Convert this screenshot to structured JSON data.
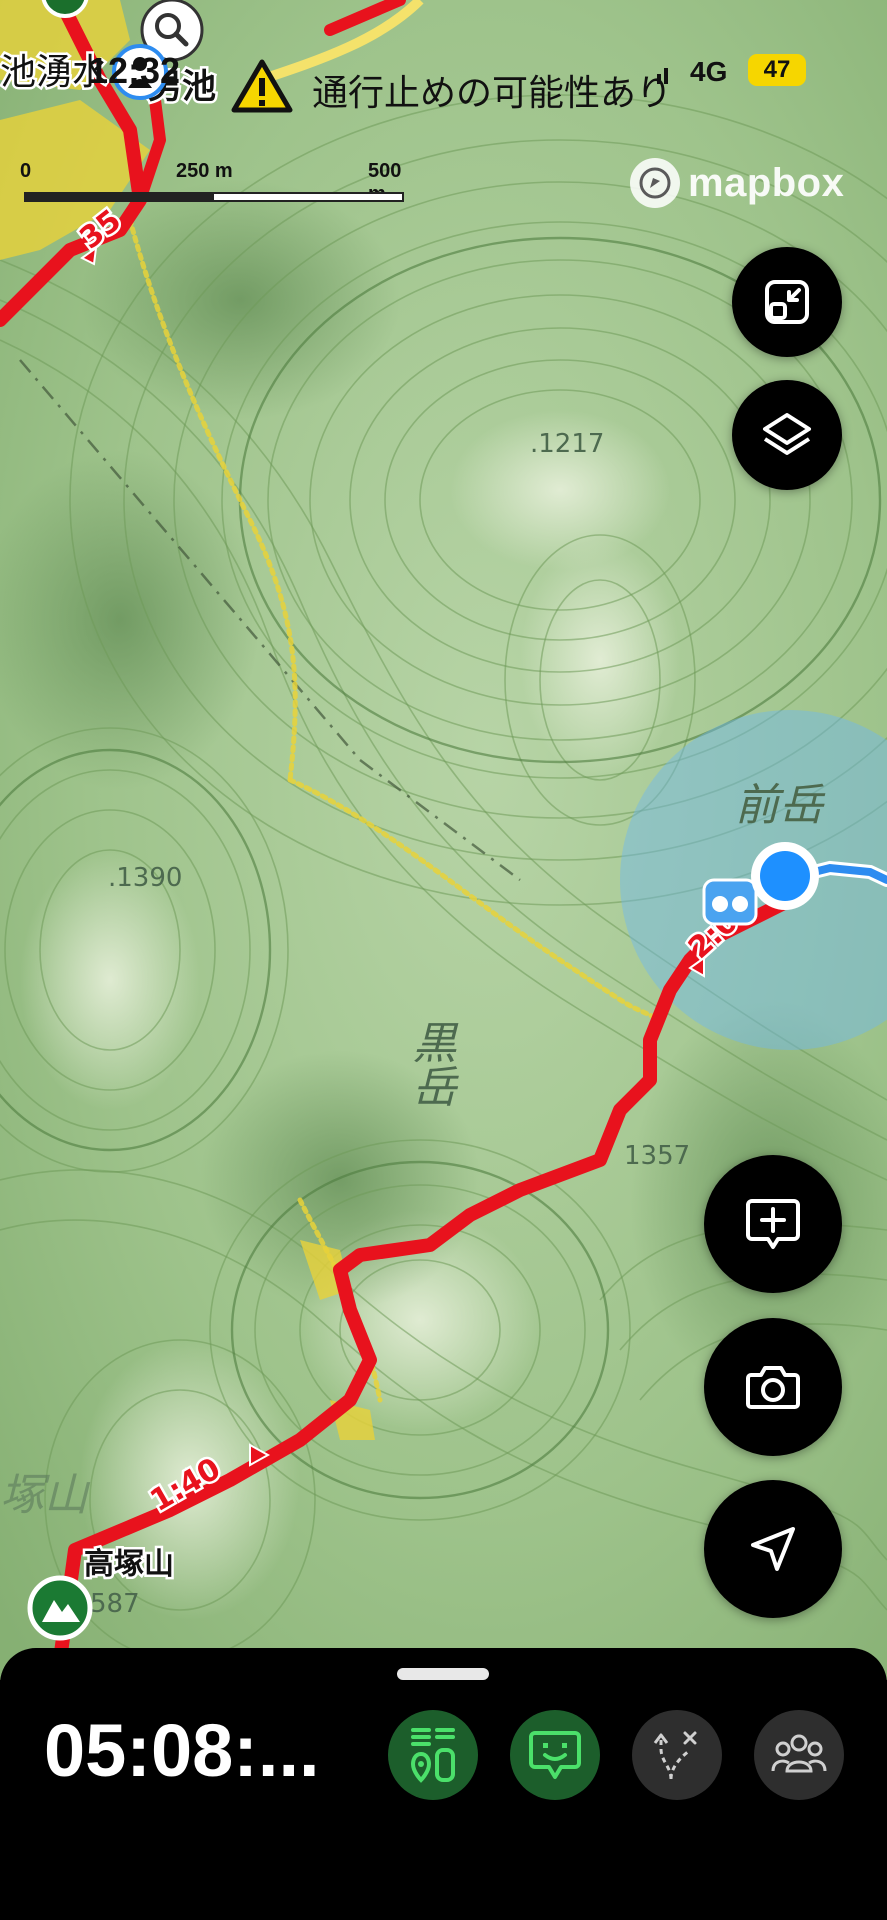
{
  "status_bar": {
    "time": "12:32",
    "network": "4G",
    "battery": "47"
  },
  "warning": {
    "icon": "warning-triangle-icon",
    "text": "通行止めの可能性あり"
  },
  "scale_bar": {
    "labels": [
      "0",
      "250 m",
      "500 m"
    ]
  },
  "attribution": {
    "brand": "mapbox"
  },
  "map": {
    "place_labels": {
      "spring_top": "池湧水",
      "pond": "男池",
      "peak_front": "前岳",
      "mountain": "黒岳",
      "summit": "高塚山",
      "summit_faded": "塚山"
    },
    "elevations": {
      "e1217": ".1217",
      "e1390": ".1390",
      "e1357": "1357",
      "e1587": "587"
    },
    "route_times": {
      "t35": "35",
      "t200": "2:00",
      "t140": "1:40"
    },
    "colors": {
      "route": "#e8121d",
      "track": "#2d8cf0",
      "location": "#1e90ff"
    }
  },
  "map_controls": {
    "collapse": "collapse-icon",
    "layers": "layers-icon",
    "add_note": "add-note-icon",
    "camera": "camera-icon",
    "locate": "navigation-arrow-icon"
  },
  "bottom_panel": {
    "elapsed_time": "05:08:...",
    "buttons": [
      "pace-icon",
      "face-message-icon",
      "route-deviation-icon",
      "group-icon"
    ],
    "accent": "#1c5e2b"
  }
}
